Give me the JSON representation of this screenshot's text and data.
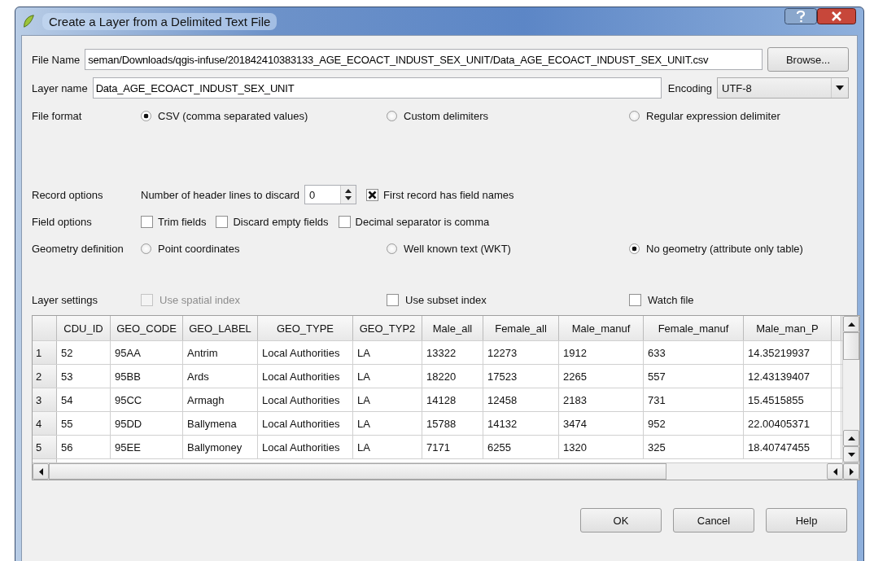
{
  "window": {
    "title": "Create a Layer from a Delimited Text File"
  },
  "file_name": {
    "label": "File Name",
    "value": "seman/Downloads/qgis-infuse/201842410383133_AGE_ECOACT_INDUST_SEX_UNIT/Data_AGE_ECOACT_INDUST_SEX_UNIT.csv",
    "button": "Browse..."
  },
  "layer_name": {
    "label": "Layer name",
    "value": "Data_AGE_ECOACT_INDUST_SEX_UNIT"
  },
  "encoding": {
    "label": "Encoding",
    "value": "UTF-8"
  },
  "file_format": {
    "label": "File format",
    "options": [
      {
        "label": "CSV (comma separated values)",
        "selected": true
      },
      {
        "label": "Custom delimiters",
        "selected": false
      },
      {
        "label": "Regular expression delimiter",
        "selected": false
      }
    ]
  },
  "record_options": {
    "label": "Record options",
    "header_lines_label": "Number of header lines to discard",
    "header_lines": "0",
    "first_record": {
      "label": "First record has field names",
      "checked": true
    }
  },
  "field_options": {
    "label": "Field options",
    "checkboxes": [
      {
        "label": "Trim fields",
        "checked": false
      },
      {
        "label": "Discard empty fields",
        "checked": false
      },
      {
        "label": "Decimal separator is comma",
        "checked": false
      }
    ]
  },
  "geometry": {
    "label": "Geometry definition",
    "options": [
      {
        "label": "Point coordinates",
        "selected": false
      },
      {
        "label": "Well known text (WKT)",
        "selected": false
      },
      {
        "label": "No geometry (attribute only table)",
        "selected": true
      }
    ]
  },
  "layer_settings": {
    "label": "Layer settings",
    "checkboxes": [
      {
        "label": "Use spatial index",
        "checked": false,
        "disabled": true
      },
      {
        "label": "Use subset index",
        "checked": false,
        "disabled": false
      },
      {
        "label": "Watch file",
        "checked": false,
        "disabled": false
      }
    ]
  },
  "table": {
    "columns": [
      "CDU_ID",
      "GEO_CODE",
      "GEO_LABEL",
      "GEO_TYPE",
      "GEO_TYP2",
      "Male_all",
      "Female_all",
      "Male_manuf",
      "Female_manuf",
      "Male_man_P"
    ],
    "rows": [
      {
        "number": "1",
        "cells": [
          "52",
          "95AA",
          "Antrim",
          "Local Authorities",
          "LA",
          "13322",
          "12273",
          "1912",
          "633",
          "14.35219937"
        ]
      },
      {
        "number": "2",
        "cells": [
          "53",
          "95BB",
          "Ards",
          "Local Authorities",
          "LA",
          "18220",
          "17523",
          "2265",
          "557",
          "12.43139407"
        ]
      },
      {
        "number": "3",
        "cells": [
          "54",
          "95CC",
          "Armagh",
          "Local Authorities",
          "LA",
          "14128",
          "12458",
          "2183",
          "731",
          "15.4515855"
        ]
      },
      {
        "number": "4",
        "cells": [
          "55",
          "95DD",
          "Ballymena",
          "Local Authorities",
          "LA",
          "15788",
          "14132",
          "3474",
          "952",
          "22.00405371"
        ]
      },
      {
        "number": "5",
        "cells": [
          "56",
          "95EE",
          "Ballymoney",
          "Local Authorities",
          "LA",
          "7171",
          "6255",
          "1320",
          "325",
          "18.40747455"
        ]
      }
    ]
  },
  "buttons": [
    "OK",
    "Cancel",
    "Help"
  ]
}
